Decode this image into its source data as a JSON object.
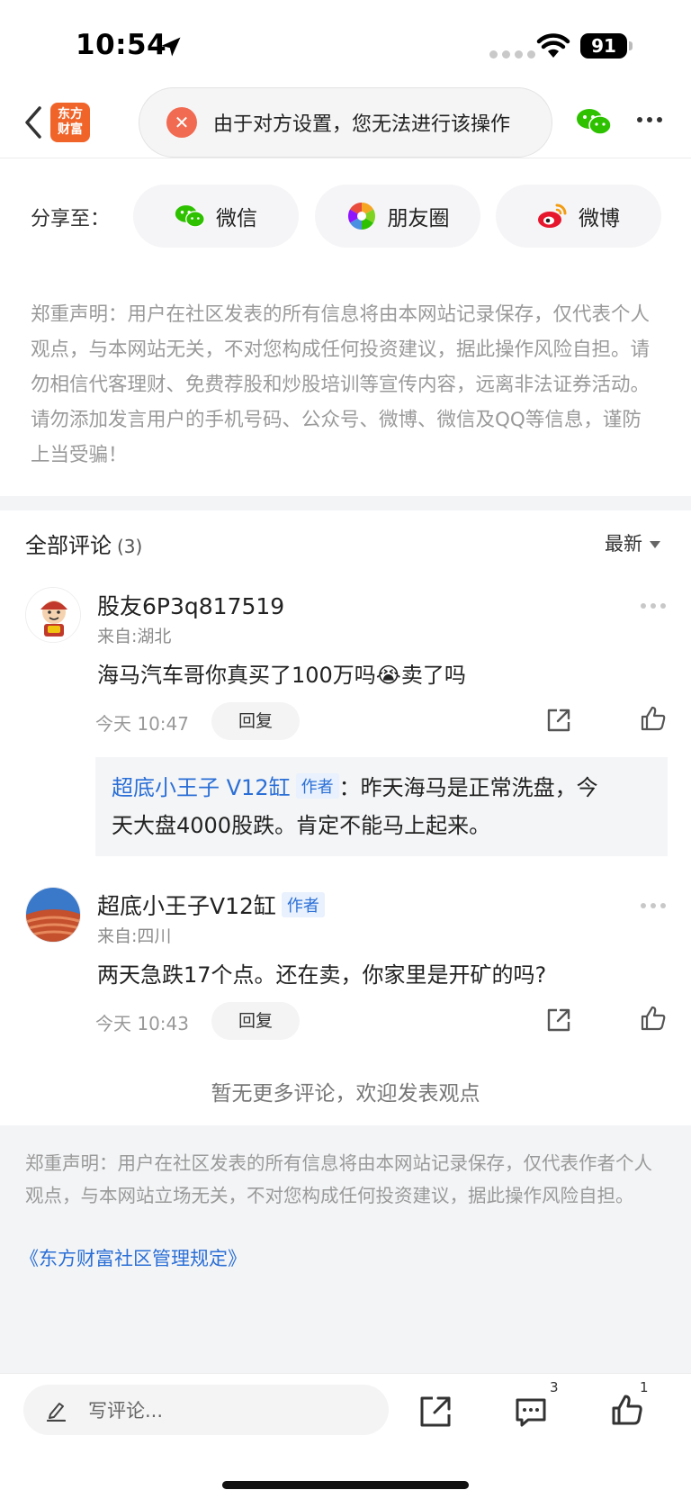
{
  "status_bar": {
    "time": "10:54",
    "battery": "91"
  },
  "nav": {
    "logo_line1": "东方",
    "logo_line2": "财富",
    "toast_text": "由于对方设置，您无法进行该操作"
  },
  "share": {
    "label": "分享至：",
    "buttons": [
      {
        "label": "微信",
        "icon": "wechat-icon"
      },
      {
        "label": "朋友圈",
        "icon": "moments-icon"
      },
      {
        "label": "微博",
        "icon": "weibo-icon"
      }
    ]
  },
  "disclaimer_top": "郑重声明：用户在社区发表的所有信息将由本网站记录保存，仅代表个人观点，与本网站无关，不对您构成任何投资建议，据此操作风险自担。请勿相信代客理财、免费荐股和炒股培训等宣传内容，远离非法证券活动。请勿添加发言用户的手机号码、公众号、微博、微信及QQ等信息，谨防上当受骗！",
  "comments_header": {
    "title": "全部评论",
    "count": "(3)",
    "sort_label": "最新"
  },
  "comments": [
    {
      "name": "股友6P3q817519",
      "from": "来自:湖北",
      "text": "海马汽车哥你真买了100万吗😭卖了吗",
      "time": "今天 10:47",
      "reply_label": "回复",
      "reply": {
        "author": "超底小王子 V12缸",
        "tag": "作者",
        "line1": "：昨天海马是正常洗盘，今",
        "line2": "天大盘4000股跌。肯定不能马上起来。"
      }
    },
    {
      "name": "超底小王子V12缸",
      "tag": "作者",
      "from": "来自:四川",
      "text": "两天急跌17个点。还在卖，你家里是开矿的吗?",
      "time": "今天 10:43",
      "reply_label": "回复"
    }
  ],
  "no_more": "暂无更多评论，欢迎发表观点",
  "disclaimer_bottom": "郑重声明：用户在社区发表的所有信息将由本网站记录保存，仅代表作者个人观点，与本网站立场无关，不对您构成任何投资建议，据此操作风险自担。",
  "rules_link": "《东方财富社区管理规定》",
  "toolbar": {
    "placeholder": "写评论...",
    "comment_count": "3",
    "like_count": "1"
  }
}
